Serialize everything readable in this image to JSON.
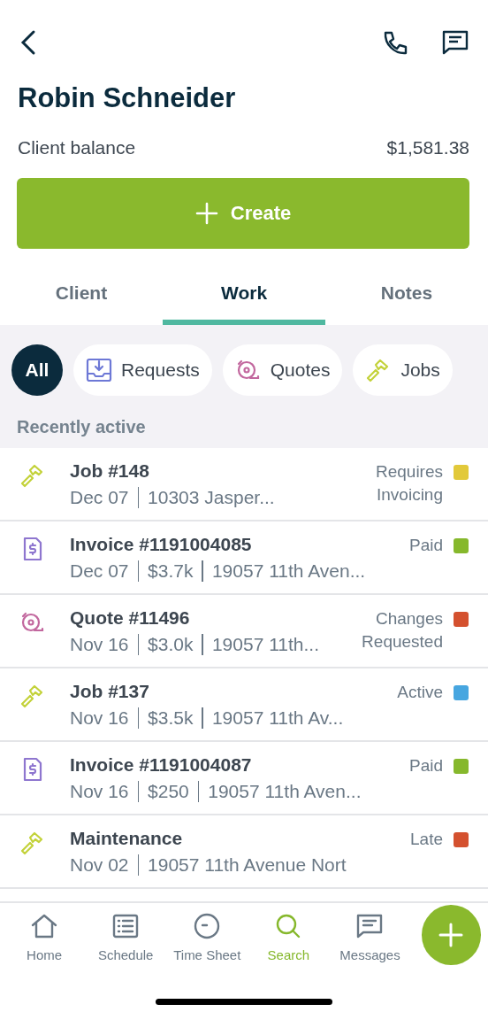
{
  "header": {
    "title": "Robin Schneider",
    "balance_label": "Client balance",
    "balance_value": "$1,581.38",
    "create_label": "Create"
  },
  "tabs": [
    {
      "label": "Client",
      "selected": false
    },
    {
      "label": "Work",
      "selected": true
    },
    {
      "label": "Notes",
      "selected": false
    }
  ],
  "filters": [
    {
      "label": "All",
      "kind": "all",
      "selected": true
    },
    {
      "label": "Requests",
      "kind": "request",
      "selected": false
    },
    {
      "label": "Quotes",
      "kind": "quote",
      "selected": false
    },
    {
      "label": "Jobs",
      "kind": "job",
      "selected": false
    }
  ],
  "section_title": "Recently active",
  "items": [
    {
      "kind": "job",
      "title": "Job #148",
      "details": [
        "Dec 07",
        "10303 Jasper..."
      ],
      "status": [
        "Requires",
        "Invoicing"
      ],
      "color": "#e2c93a"
    },
    {
      "kind": "invoice",
      "title": "Invoice #1191004085",
      "details": [
        "Dec 07",
        "$3.7k",
        "19057 11th Aven..."
      ],
      "status": [
        "Paid"
      ],
      "color": "#86b82c"
    },
    {
      "kind": "quote",
      "title": "Quote #11496",
      "details": [
        "Nov 16",
        "$3.0k",
        "19057 11th..."
      ],
      "status": [
        "Changes",
        "Requested"
      ],
      "color": "#d4512f"
    },
    {
      "kind": "job",
      "title": "Job #137",
      "details": [
        "Nov 16",
        "$3.5k",
        "19057 11th Av..."
      ],
      "status": [
        "Active"
      ],
      "color": "#47a6e0"
    },
    {
      "kind": "invoice",
      "title": "Invoice #1191004087",
      "details": [
        "Nov 16",
        "$250",
        "19057 11th Aven..."
      ],
      "status": [
        "Paid"
      ],
      "color": "#86b82c"
    },
    {
      "kind": "job",
      "title": "Maintenance",
      "details": [
        "Nov 02",
        "19057 11th Avenue Nort"
      ],
      "status": [
        "Late"
      ],
      "color": "#d4512f"
    }
  ],
  "nav": [
    {
      "label": "Home",
      "kind": "home",
      "selected": false
    },
    {
      "label": "Schedule",
      "kind": "schedule",
      "selected": false
    },
    {
      "label": "Time Sheet",
      "kind": "timesheet",
      "selected": false
    },
    {
      "label": "Search",
      "kind": "search",
      "selected": true
    },
    {
      "label": "Messages",
      "kind": "messages",
      "selected": false
    }
  ]
}
